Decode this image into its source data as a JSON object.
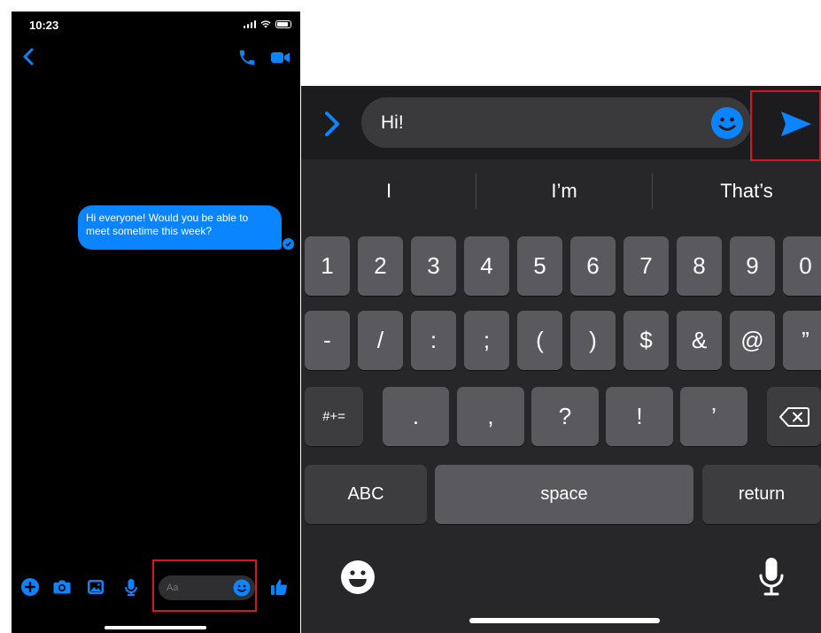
{
  "status_bar": {
    "time": "10:23"
  },
  "header": {
    "back_icon": "chevron-left-icon",
    "call_icon": "phone-icon",
    "video_icon": "video-camera-icon"
  },
  "thread": {
    "messages": [
      {
        "text": "Hi everyone! Would you be able to meet sometime this week?",
        "from": "me",
        "status": "seen"
      }
    ]
  },
  "composer": {
    "placeholder": "Aa",
    "value": "",
    "tool_icons": [
      "plus-icon",
      "camera-icon",
      "photo-icon",
      "microphone-icon"
    ],
    "like_icon": "thumbs-up-icon"
  },
  "keyboard_view": {
    "input_value": "Hi!",
    "send_icon": "send-icon",
    "suggestions": [
      "I",
      "I’m",
      "That’s"
    ],
    "rows": [
      [
        "1",
        "2",
        "3",
        "4",
        "5",
        "6",
        "7",
        "8",
        "9",
        "0"
      ],
      [
        "-",
        "/",
        ":",
        ";",
        "(",
        ")",
        "$",
        "&",
        "@",
        "”"
      ],
      [
        ".",
        ",",
        "?",
        "!",
        "’"
      ]
    ],
    "symbols_key": "#+=",
    "abc_key": "ABC",
    "space_key": "space",
    "return_key": "return"
  },
  "colors": {
    "accent": "#0a84ff",
    "highlight": "#e0121d",
    "background": "#000000",
    "keyboard_bg": "#272729",
    "key": "#5a5a5e",
    "key_dark": "#3d3d40"
  }
}
